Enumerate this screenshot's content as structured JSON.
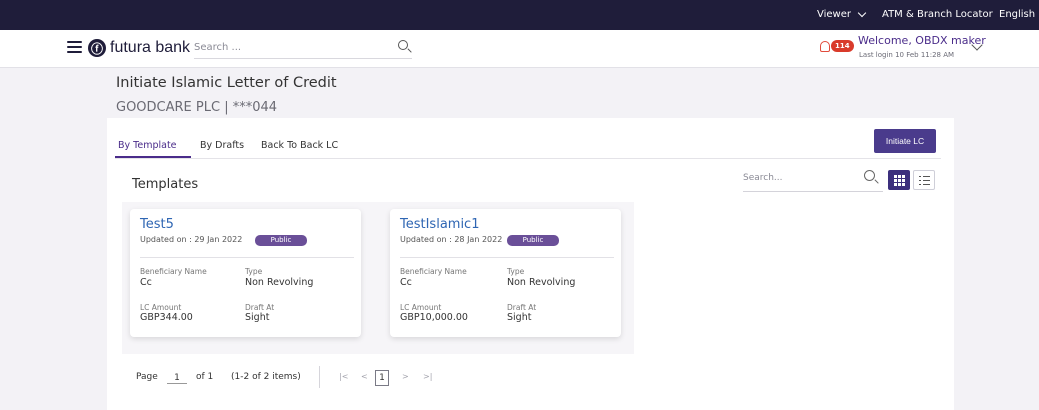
{
  "topbar": {
    "viewer": "Viewer",
    "atm": "ATM & Branch Locator",
    "language": "English"
  },
  "header": {
    "logo_text": "futura bank",
    "search_placeholder": "Search ...",
    "notifications_count": "114",
    "welcome": "Welcome, OBDX maker",
    "last_login": "Last login 10 Feb 11:28 AM"
  },
  "page": {
    "title": "Initiate Islamic Letter of Credit",
    "subtitle": "GOODCARE PLC | ***044"
  },
  "tabs": [
    {
      "label": "By Template",
      "active": true
    },
    {
      "label": "By Drafts",
      "active": false
    },
    {
      "label": "Back To Back LC",
      "active": false
    }
  ],
  "initiate_button": "Initiate LC",
  "templates": {
    "title": "Templates",
    "search_placeholder": "Search...",
    "items": [
      {
        "name": "Test5",
        "updated": "Updated on : 29 Jan 2022",
        "visibility": "Public",
        "beneficiary_label": "Beneficiary Name",
        "beneficiary": "Cc",
        "type_label": "Type",
        "type": "Non Revolving",
        "amount_label": "LC Amount",
        "amount": "GBP344.00",
        "draft_label": "Draft At",
        "draft": "Sight"
      },
      {
        "name": "TestIslamic1",
        "updated": "Updated on : 28 Jan 2022",
        "visibility": "Public",
        "beneficiary_label": "Beneficiary Name",
        "beneficiary": "Cc",
        "type_label": "Type",
        "type": "Non Revolving",
        "amount_label": "LC Amount",
        "amount": "GBP10,000.00",
        "draft_label": "Draft At",
        "draft": "Sight"
      }
    ]
  },
  "pagination": {
    "page_label": "Page",
    "page": "1",
    "of": "of 1",
    "items": "(1-2 of 2 items)",
    "first": "|<",
    "prev": "<",
    "current": "1",
    "next": ">",
    "last": ">|"
  }
}
